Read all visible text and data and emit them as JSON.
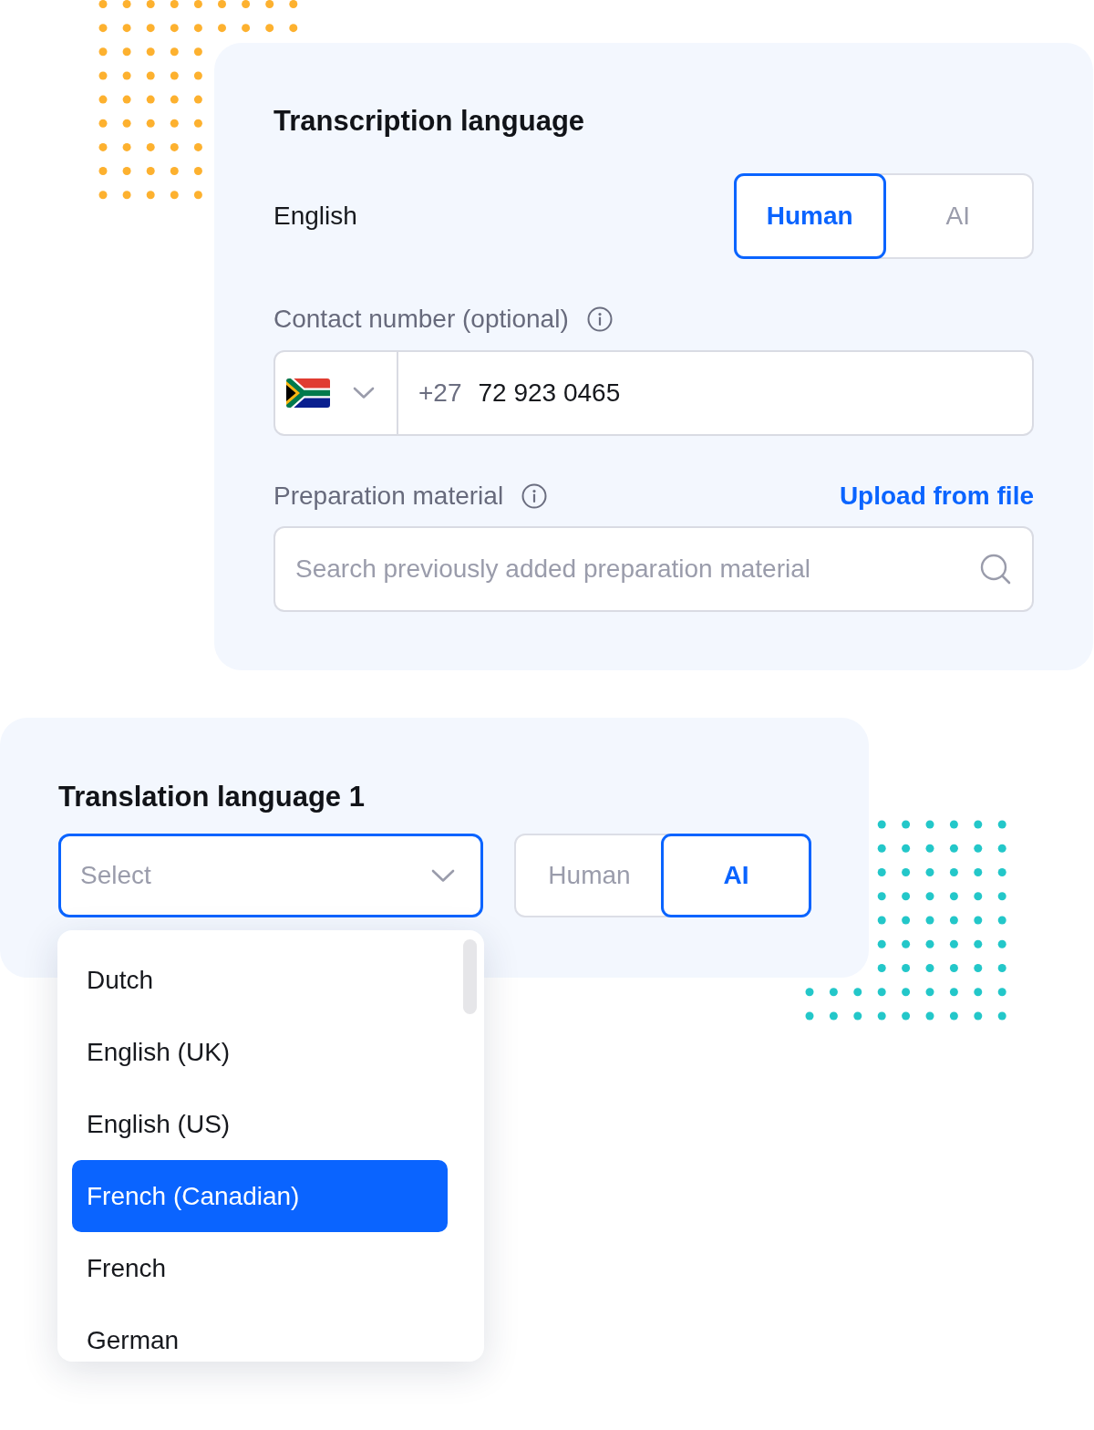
{
  "transcription": {
    "title": "Transcription language",
    "language": "English",
    "modes": [
      {
        "label": "Human",
        "selected": true
      },
      {
        "label": "AI",
        "selected": false
      }
    ],
    "contact": {
      "label": "Contact number (optional)",
      "country_code": "+27",
      "number": "72 923 0465"
    },
    "preparation": {
      "label": "Preparation material",
      "upload_link": "Upload from file",
      "search": {
        "placeholder": "Search previously added preparation material"
      }
    }
  },
  "translation": {
    "title": "Translation language 1",
    "select": {
      "placeholder": "Select"
    },
    "modes": [
      {
        "label": "Human",
        "selected": false
      },
      {
        "label": "AI",
        "selected": true
      }
    ],
    "dropdown": {
      "options": [
        {
          "label": "Dutch",
          "selected": false
        },
        {
          "label": "English (UK)",
          "selected": false
        },
        {
          "label": "English (US)",
          "selected": false
        },
        {
          "label": "French (Canadian)",
          "selected": true
        },
        {
          "label": "French",
          "selected": false
        },
        {
          "label": "German",
          "selected": false
        }
      ]
    }
  }
}
